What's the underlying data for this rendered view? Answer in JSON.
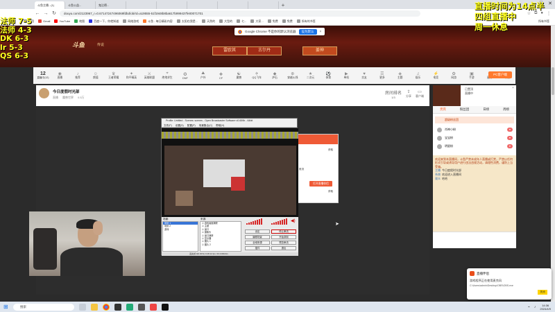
{
  "browser": {
    "tabs": [
      "斗鱼主播...(1)",
      "斗鱼公益...",
      "鬼泣德...",
      "",
      "",
      "",
      "",
      ""
    ],
    "new_tab": "+",
    "url": "douyu.com/2123967_r=0.67147247496069fdbd/ob/rd=a19555-51f1948b8ba617b999437fe00071701",
    "bookmarks": [
      "应用",
      "Gmail",
      "YouTube",
      "地图",
      "百度一下，你就知道",
      "网络游戏",
      "斗鱼 - 每日精彩内容",
      "太阳在我是...",
      "天然的",
      "大型的",
      "七...",
      "大家...",
      "免费",
      "免费",
      "所有的书签",
      "所有书签"
    ]
  },
  "chrome_prompt": {
    "message": "Google Chrome 不是你的默认浏览器",
    "button": "设为默认",
    "close": "×"
  },
  "banner": {
    "logo": "斗鱼",
    "logo_sub": "传说",
    "buttons": [
      "雷欧其",
      "古尔丹",
      "姜神"
    ]
  },
  "categories": {
    "first": {
      "num": "12",
      "label": "直播中(12)"
    },
    "items": [
      "直播",
      "推荐",
      "颜值",
      "王者荣耀",
      "和平精英",
      "英雄联盟",
      "绝地求生",
      "DNF",
      "户外",
      "CF",
      "魔兽",
      "QQ飞车",
      "炉石",
      "穿越火线",
      "二次元",
      "体育",
      "单机",
      "交友",
      "更多",
      "主题",
      "娱乐",
      "电竞",
      "网游",
      "手游",
      "星秀",
      "科技",
      "付费",
      "赛事"
    ],
    "pc_button": "PC客户端"
  },
  "room": {
    "title": "今日度假时光部",
    "meta": [
      "直播",
      "魔兽世界",
      "0.5万"
    ],
    "right": [
      {
        "label": "1/3",
        "sub": "房间排名"
      },
      {
        "label": "分享",
        "sub": ""
      },
      {
        "label": "客户端",
        "sub": ""
      }
    ]
  },
  "obs": {
    "title": "Profile: Untitled - Scenes: scenes - Open Broadcaster Software v0.659b - 64bit",
    "menu": [
      "文件(F)",
      "设置(S)",
      "配置(P)",
      "场景集合(C)",
      "帮助(H)"
    ],
    "scenes_label": "场景:",
    "sources_label": "来源:",
    "scenes": [
      "场景 1",
      "场景 2",
      "游戏"
    ],
    "sources": [
      "游戏画面捕获",
      "主题",
      "窗口",
      "摄像头",
      "窗口捕获",
      "显示器",
      "图片 1",
      "图片 2"
    ],
    "buttons": [
      "设定",
      "停止串流",
      "编辑场景",
      "开始录制",
      "全域来源",
      "预览串流",
      "插件",
      "退出"
    ],
    "status": "丢失帧 0(0.00%)   0:48:12   fps: 60   2400kb/s"
  },
  "popup": {
    "lines": [
      "获取",
      "推流",
      "获取"
    ],
    "button": "打开直播伴侣"
  },
  "sidebar": {
    "pin": "已置顶",
    "pin2": "直播中",
    "tabs": [
      "贵宾",
      "粉丝团",
      "日榜",
      "周榜"
    ],
    "rank_head": "超级粉丝团",
    "rank": [
      {
        "name": "肖神小粉"
      },
      {
        "name": "宝宝粉"
      },
      {
        "name": "明星粉"
      }
    ],
    "notice": "欢迎来到本直播间，斗鱼严禁未成年人直播或打赏，严禁以任何形式引导或诱导用户进行违法违规活动，请理性消费，谨防上当受骗。",
    "chat": [
      {
        "user": "主播",
        "text": "今日度假时光部"
      },
      {
        "user": "系统",
        "text": "欢迎进入直播间"
      },
      {
        "user": "观众",
        "text": "哈哈"
      }
    ]
  },
  "notification": {
    "title": "直播伴侣",
    "message": "游戏程序正在使用麦克风",
    "path": "C:\\Users\\admin\\Desktop\\OBS\\OBS.exe",
    "button": "关闭"
  },
  "taskbar": {
    "search": "搜索",
    "time": "14:36",
    "date": "2024/4/9"
  },
  "overlay_left": [
    "",
    "",
    "法师 7-5",
    "法师 4-3",
    "DK 6-3",
    "lr 5-3",
    "QS 6-3"
  ],
  "overlay_right": [
    "直播时间为14点半",
    "四组直播中",
    "周一休息"
  ],
  "colors": {
    "accent": "#ff5d23",
    "overlay": "#ffff1f",
    "banner": "#6a1b10"
  }
}
